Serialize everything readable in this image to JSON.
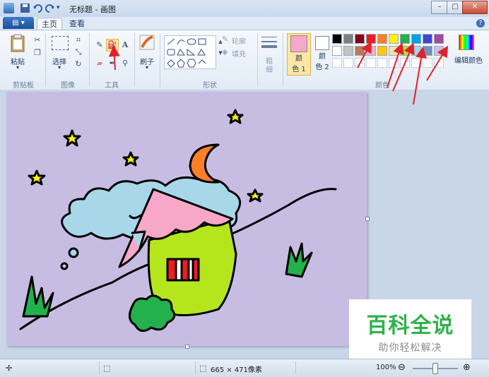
{
  "window": {
    "title": "无标题 - 画图",
    "minimize_label": "–",
    "maximize_label": "□",
    "close_label": "✕"
  },
  "tabs": {
    "file_label": "▤ ▾",
    "home": "主页",
    "view": "查看",
    "help": "?"
  },
  "ribbon": {
    "clipboard": {
      "paste": "粘贴",
      "paste_arrow": "▾",
      "group": "剪贴板"
    },
    "image": {
      "select": "选择",
      "select_arrow": "▾",
      "group": "图像"
    },
    "tools": {
      "text_tool": "A",
      "group": "工具"
    },
    "brush": {
      "label": "刷子",
      "arrow": "▾"
    },
    "shapes": {
      "outline": "轮廓",
      "fill": "填充",
      "group": "形状"
    },
    "size": {
      "label": "粗",
      "label2": "细",
      "arrow": "▾"
    },
    "colors": {
      "color1": "颜",
      "color1b": "色 1",
      "color2": "颜",
      "color2b": "色 2",
      "edit": "编辑颜色",
      "group": "颜色",
      "color1_value": "#f7a8c9",
      "color2_value": "#ffffff",
      "palette_row1": [
        "#000000",
        "#7f7f7f",
        "#880015",
        "#ed1c24",
        "#ff7f27",
        "#fff200",
        "#22b14c",
        "#00a2e8",
        "#3f48cc",
        "#a349a4"
      ],
      "palette_row2": [
        "#ffffff",
        "#c3c3c3",
        "#b97a57",
        "#ffaec9",
        "#ffc90e",
        "#efe4b0",
        "#b5e61d",
        "#99d9ea",
        "#7092be",
        "#c8bfe7"
      ]
    }
  },
  "canvas": {
    "background": "#c7bde3"
  },
  "watermark": {
    "main": "百科全说",
    "sub": "助你轻松解决"
  },
  "statusbar": {
    "move_icon": "✢",
    "selection_icon": "⬚",
    "size_icon": "⬚",
    "size": "665 × 471像素",
    "zoom": "100%",
    "zoom_out": "⊖",
    "zoom_in": "⊕"
  }
}
